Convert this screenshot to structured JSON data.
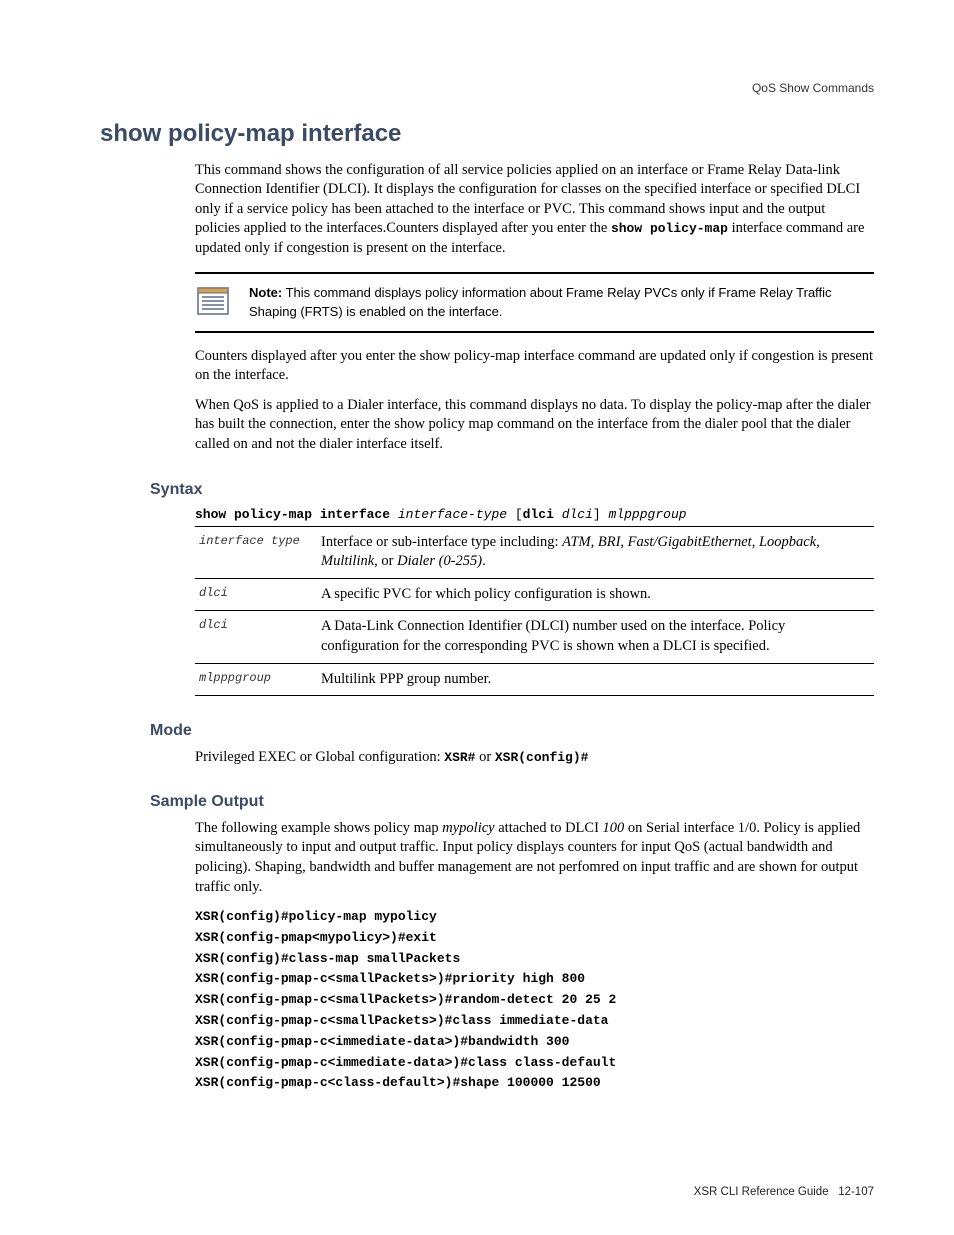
{
  "header": {
    "right": "QoS Show Commands"
  },
  "title": "show policy-map interface",
  "intro": {
    "p1a": "This command shows the configuration of all service policies applied on an interface or Frame Relay Data-link Connection Identifier (DLCI). It displays the configuration for classes on the specified interface or specified DLCI only if a service policy has been attached to the interface or PVC. This command shows input and the output policies applied to the interfaces.Counters displayed after you enter the ",
    "p1code": "show policy-map",
    "p1b": " interface command are updated only if congestion is present on the interface."
  },
  "note": {
    "label": "Note:",
    "text": " This command displays policy information about Frame Relay PVCs only if Frame Relay Traffic Shaping (FRTS) is enabled on the interface."
  },
  "after_note": {
    "p1": "Counters displayed after you enter the show policy-map interface command are updated only if congestion is present on the interface.",
    "p2": "When QoS is applied to a Dialer interface, this command displays no data. To display the policy-map after the dialer has built the connection, enter the show policy map command on the interface from the dialer pool that the dialer called on and not the dialer interface itself."
  },
  "syntax": {
    "heading": "Syntax",
    "cmd_bold1": "show policy-map interface ",
    "cmd_i1": "interface-type",
    "cmd_plain1": " [",
    "cmd_bold2": "dlci",
    "cmd_plain2": " ",
    "cmd_i2": "dlci",
    "cmd_plain3": "] ",
    "cmd_i3": "mlpppgroup",
    "rows": [
      {
        "name": "interface type",
        "desc_a": "Interface or sub-interface type including: ",
        "desc_em": "ATM, BRI, Fast/GigabitEthernet, Loopback, Multilink,",
        "desc_b": " or ",
        "desc_em2": "Dialer (0-255)",
        "desc_c": "."
      },
      {
        "name": "dlci",
        "desc": "A specific PVC for which policy configuration is shown."
      },
      {
        "name": "dlci",
        "desc": "A Data-Link Connection Identifier (DLCI) number used on the interface. Policy configuration for the corresponding PVC is shown when a DLCI is specified."
      },
      {
        "name": "mlpppgroup",
        "desc": "Multilink PPP group number."
      }
    ]
  },
  "mode": {
    "heading": "Mode",
    "text_a": "Privileged EXEC or Global configuration: ",
    "code1": "XSR#",
    "text_b": " or ",
    "code2": "XSR(config)#"
  },
  "sample": {
    "heading": "Sample Output",
    "intro_a": "The following example shows policy map ",
    "intro_em1": "mypolicy",
    "intro_b": " attached to DLCI ",
    "intro_em2": "100",
    "intro_c": " on Serial interface 1/0. Policy is applied simultaneously to input and output traffic. Input policy displays counters for input QoS (actual bandwidth and policing). Shaping, bandwidth and buffer management are not perfomred on input traffic and are shown for output traffic only.",
    "code": "XSR(config)#policy-map mypolicy\nXSR(config-pmap<mypolicy>)#exit\nXSR(config)#class-map smallPackets\nXSR(config-pmap-c<smallPackets>)#priority high 800\nXSR(config-pmap-c<smallPackets>)#random-detect 20 25 2\nXSR(config-pmap-c<smallPackets>)#class immediate-data\nXSR(config-pmap-c<immediate-data>)#bandwidth 300\nXSR(config-pmap-c<immediate-data>)#class class-default\nXSR(config-pmap-c<class-default>)#shape 100000 12500"
  },
  "footer": {
    "guide": "XSR CLI Reference Guide",
    "page": "12-107"
  }
}
